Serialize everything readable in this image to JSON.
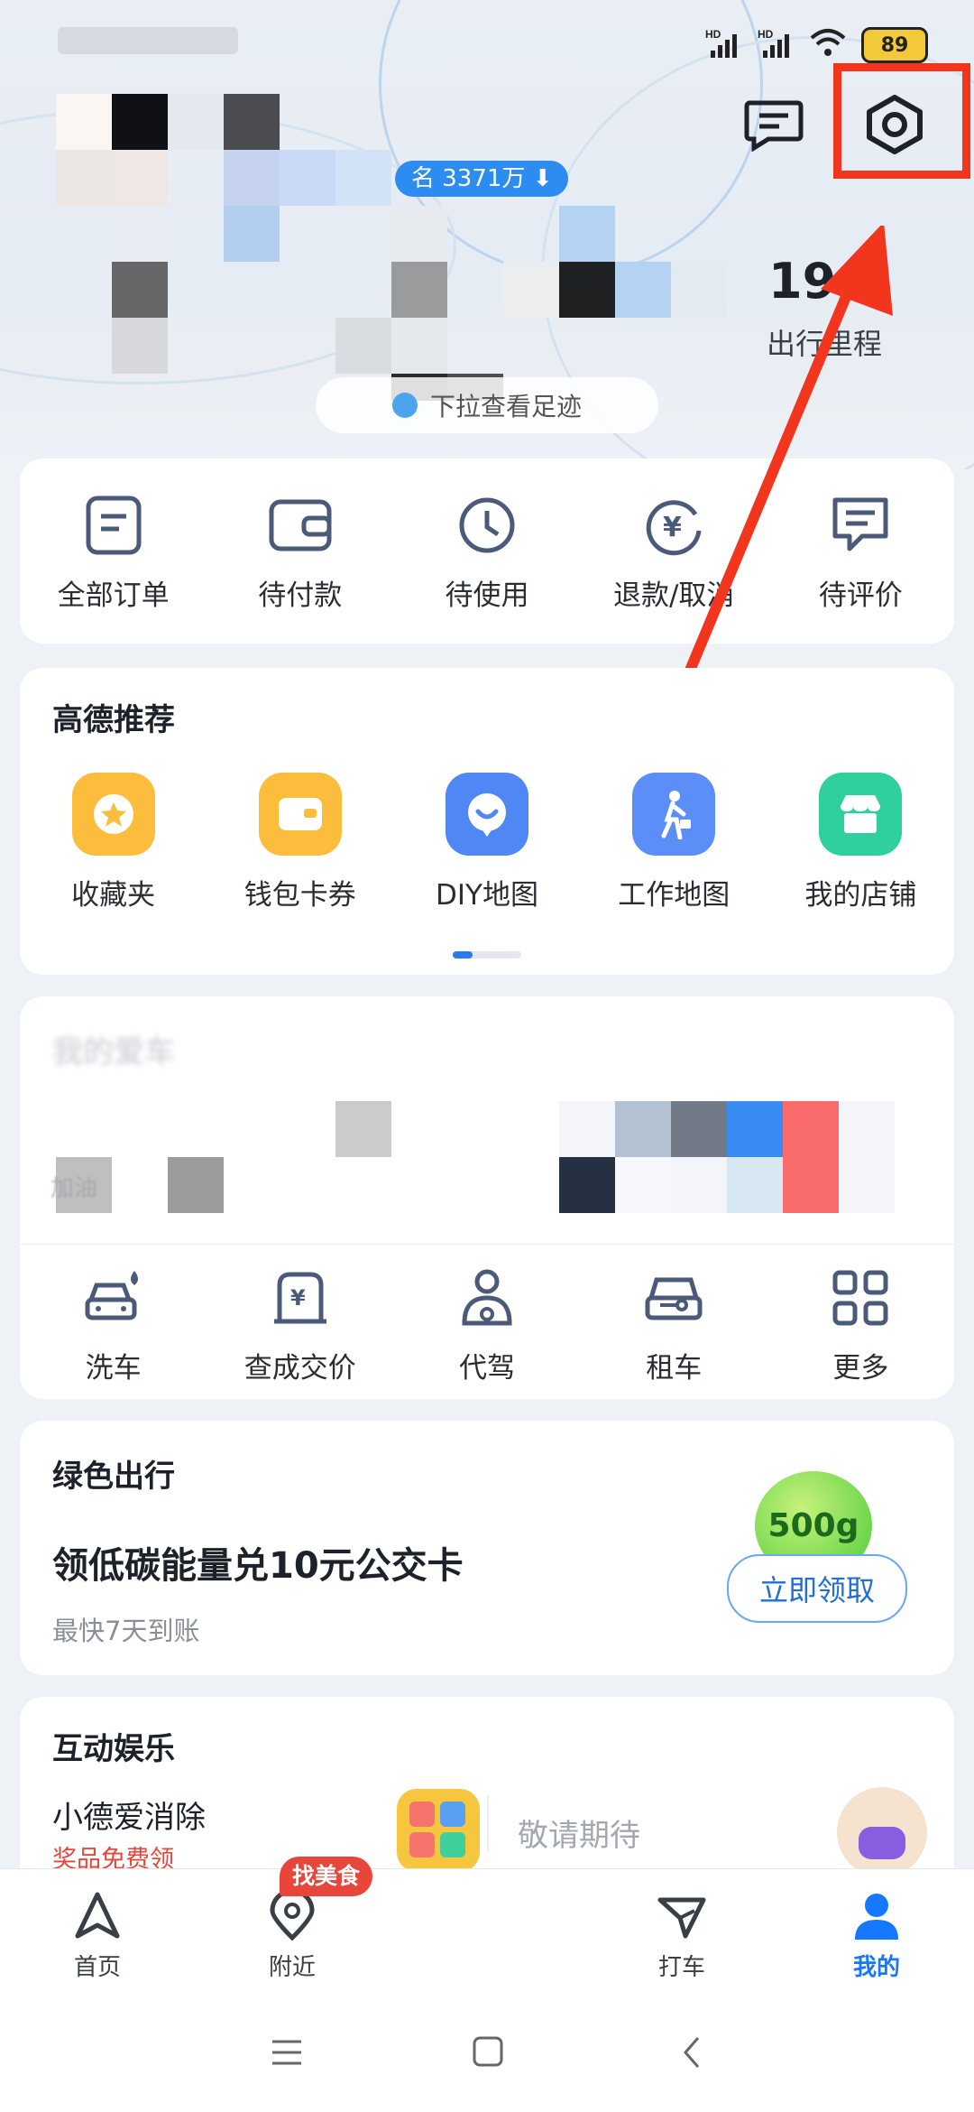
{
  "status": {
    "battery": "89",
    "network_a": "HD",
    "network_b": "HD"
  },
  "header": {
    "time_partial": "17:...",
    "rank_badge": "名 3371万 ⬇",
    "trip_value": "19",
    "trip_label": "出行里程",
    "pull_hint": "下拉查看足迹"
  },
  "orders": [
    {
      "label": "全部订单",
      "icon": "order-list-icon"
    },
    {
      "label": "待付款",
      "icon": "wallet-icon"
    },
    {
      "label": "待使用",
      "icon": "clock-icon"
    },
    {
      "label": "退款/取消",
      "icon": "refund-icon"
    },
    {
      "label": "待评价",
      "icon": "comment-icon"
    }
  ],
  "recommend": {
    "title": "高德推荐",
    "items": [
      {
        "label": "收藏夹",
        "icon": "star-icon",
        "color": "#fbbd3b"
      },
      {
        "label": "钱包卡券",
        "icon": "wallet-card-icon",
        "color": "#fbbd3b"
      },
      {
        "label": "DIY地图",
        "icon": "diy-map-icon",
        "color": "#4f87f5"
      },
      {
        "label": "工作地图",
        "icon": "work-map-icon",
        "color": "#5b8ff7"
      },
      {
        "label": "我的店铺",
        "icon": "shop-icon",
        "color": "#2fcf9e"
      }
    ]
  },
  "car": {
    "title_partial": "我的爱车",
    "left_partial": "加油",
    "items": [
      {
        "label": "洗车",
        "icon": "car-wash-icon"
      },
      {
        "label": "查成交价",
        "icon": "car-price-icon"
      },
      {
        "label": "代驾",
        "icon": "driver-icon"
      },
      {
        "label": "租车",
        "icon": "car-rental-icon"
      },
      {
        "label": "更多",
        "icon": "grid-more-icon"
      }
    ]
  },
  "green": {
    "title": "绿色出行",
    "headline": "领低碳能量兑10元公交卡",
    "sub": "最快7天到账",
    "badge": "500g",
    "cta": "立即领取"
  },
  "fun": {
    "title": "互动娱乐",
    "game_title": "小德爱消除",
    "game_sub": "奖品免费领",
    "coming": "敬请期待"
  },
  "nav": [
    {
      "label": "首页",
      "icon": "navigate-icon"
    },
    {
      "label": "附近",
      "icon": "location-icon",
      "badge": "找美食"
    },
    {
      "label": "打车",
      "icon": "taxi-icon"
    },
    {
      "label": "我的",
      "icon": "user-icon",
      "active": true
    }
  ],
  "colors": {
    "accent": "#1677ff",
    "arrow": "#f2361d",
    "danger": "#e8463b"
  }
}
